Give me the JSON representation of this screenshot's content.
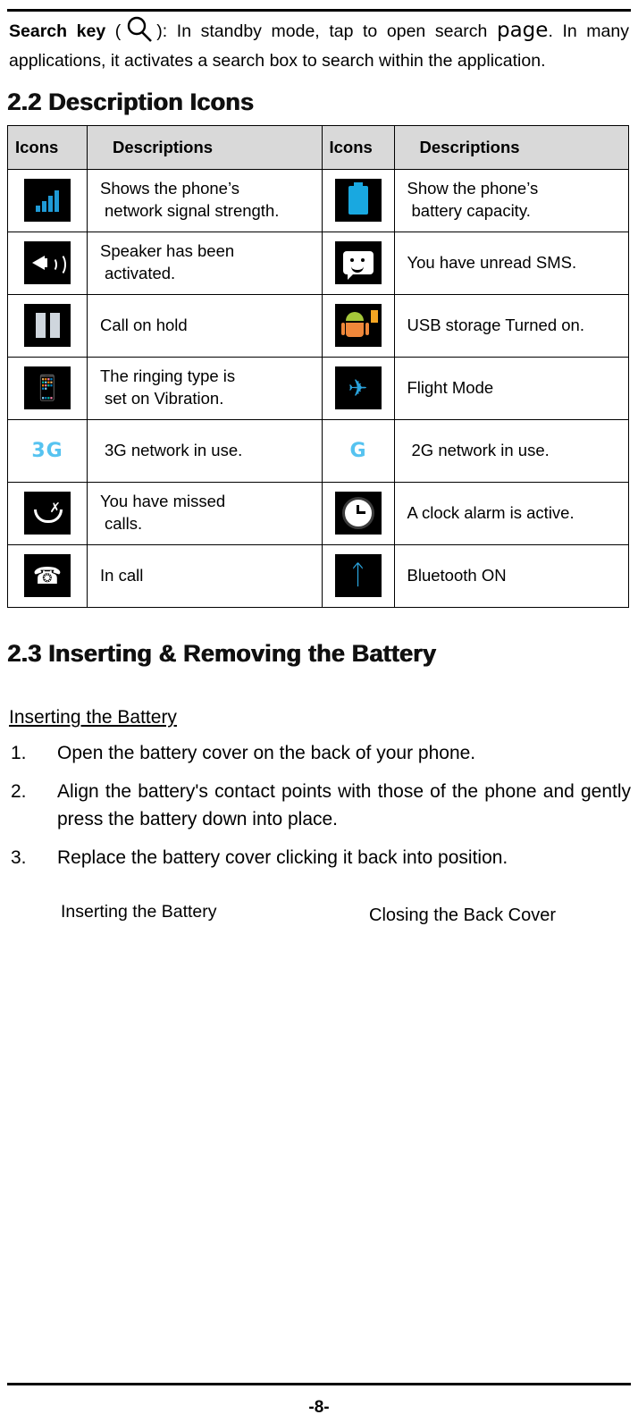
{
  "intro": {
    "label": "Search key",
    "paren_open": "(",
    "paren_close": "):",
    "text_part1": "In standby mode, tap to open search",
    "big_word": "page",
    "text_part2": ". In many applications, it activates a search box to search within the application."
  },
  "sections": {
    "icons_heading": "2.2 Description Icons",
    "battery_heading": "2.3 Inserting & Removing the Battery"
  },
  "icon_table": {
    "headers": [
      "Icons",
      "Descriptions",
      "Icons",
      "Descriptions"
    ],
    "rows": [
      {
        "left_icon": "signal-bars-icon",
        "left_desc_line1": "Shows the phone’s",
        "left_desc_line2": "network signal strength.",
        "right_icon": "battery-icon",
        "right_desc_line1": "Show the phone’s",
        "right_desc_line2": "battery capacity."
      },
      {
        "left_icon": "speaker-icon",
        "left_desc_line1": "Speaker has been",
        "left_desc_line2": "activated.",
        "right_icon": "sms-message-icon",
        "right_desc_line1": "You have unread SMS.",
        "right_desc_line2": ""
      },
      {
        "left_icon": "call-hold-icon",
        "left_desc_line1": "Call on hold",
        "left_desc_line2": "",
        "right_icon": "usb-android-icon",
        "right_desc_line1": "USB storage Turned on.",
        "right_desc_line2": ""
      },
      {
        "left_icon": "vibration-icon",
        "left_desc_line1": "The ringing type is",
        "left_desc_line2": "set on Vibration.",
        "right_icon": "airplane-icon",
        "right_desc_line1": "Flight Mode",
        "right_desc_line2": ""
      },
      {
        "left_icon": "3g-network-icon",
        "left_icon_text": "3G",
        "left_desc_line1": "3G network in use.",
        "left_desc_line2": "",
        "right_icon": "2g-network-icon",
        "right_icon_text": "G",
        "right_desc_line1": "2G network in use.",
        "right_desc_line2": ""
      },
      {
        "left_icon": "missed-call-icon",
        "left_desc_line1": "You have missed",
        "left_desc_line2": "calls.",
        "right_icon": "alarm-clock-icon",
        "right_desc_line1": "A clock alarm is active.",
        "right_desc_line2": ""
      },
      {
        "left_icon": "in-call-icon",
        "left_desc_line1": "In call",
        "left_desc_line2": "",
        "right_icon": "bluetooth-icon",
        "right_desc_line1": "Bluetooth ON",
        "right_desc_line2": ""
      }
    ]
  },
  "battery_section": {
    "subheading": "Inserting the Battery",
    "steps": [
      {
        "num": "1.",
        "text": "Open the battery cover on the back of your phone."
      },
      {
        "num": "2.",
        "text": "Align the battery's contact points with those of the phone and gently press the battery down into place."
      },
      {
        "num": "3.",
        "text": "Replace the battery cover clicking it back into position."
      }
    ],
    "caption_left": "Inserting the Battery",
    "caption_right": "Closing the Back Cover"
  },
  "footer": {
    "page_number": "-8-"
  },
  "colors": {
    "accent_blue": "#2aa3dd",
    "header_gray": "#d9d9d9",
    "android_green": "#a4c639",
    "android_orange": "#f0873a"
  }
}
